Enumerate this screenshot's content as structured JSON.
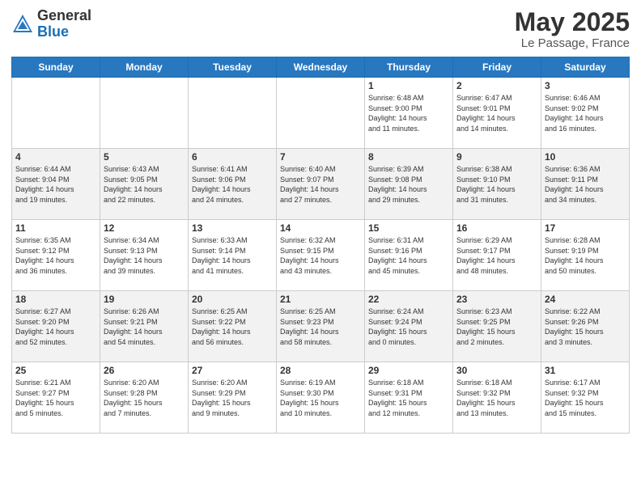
{
  "logo": {
    "general": "General",
    "blue": "Blue"
  },
  "title": "May 2025",
  "subtitle": "Le Passage, France",
  "days_of_week": [
    "Sunday",
    "Monday",
    "Tuesday",
    "Wednesday",
    "Thursday",
    "Friday",
    "Saturday"
  ],
  "weeks": [
    [
      {
        "day": "",
        "info": ""
      },
      {
        "day": "",
        "info": ""
      },
      {
        "day": "",
        "info": ""
      },
      {
        "day": "",
        "info": ""
      },
      {
        "day": "1",
        "info": "Sunrise: 6:48 AM\nSunset: 9:00 PM\nDaylight: 14 hours\nand 11 minutes."
      },
      {
        "day": "2",
        "info": "Sunrise: 6:47 AM\nSunset: 9:01 PM\nDaylight: 14 hours\nand 14 minutes."
      },
      {
        "day": "3",
        "info": "Sunrise: 6:46 AM\nSunset: 9:02 PM\nDaylight: 14 hours\nand 16 minutes."
      }
    ],
    [
      {
        "day": "4",
        "info": "Sunrise: 6:44 AM\nSunset: 9:04 PM\nDaylight: 14 hours\nand 19 minutes."
      },
      {
        "day": "5",
        "info": "Sunrise: 6:43 AM\nSunset: 9:05 PM\nDaylight: 14 hours\nand 22 minutes."
      },
      {
        "day": "6",
        "info": "Sunrise: 6:41 AM\nSunset: 9:06 PM\nDaylight: 14 hours\nand 24 minutes."
      },
      {
        "day": "7",
        "info": "Sunrise: 6:40 AM\nSunset: 9:07 PM\nDaylight: 14 hours\nand 27 minutes."
      },
      {
        "day": "8",
        "info": "Sunrise: 6:39 AM\nSunset: 9:08 PM\nDaylight: 14 hours\nand 29 minutes."
      },
      {
        "day": "9",
        "info": "Sunrise: 6:38 AM\nSunset: 9:10 PM\nDaylight: 14 hours\nand 31 minutes."
      },
      {
        "day": "10",
        "info": "Sunrise: 6:36 AM\nSunset: 9:11 PM\nDaylight: 14 hours\nand 34 minutes."
      }
    ],
    [
      {
        "day": "11",
        "info": "Sunrise: 6:35 AM\nSunset: 9:12 PM\nDaylight: 14 hours\nand 36 minutes."
      },
      {
        "day": "12",
        "info": "Sunrise: 6:34 AM\nSunset: 9:13 PM\nDaylight: 14 hours\nand 39 minutes."
      },
      {
        "day": "13",
        "info": "Sunrise: 6:33 AM\nSunset: 9:14 PM\nDaylight: 14 hours\nand 41 minutes."
      },
      {
        "day": "14",
        "info": "Sunrise: 6:32 AM\nSunset: 9:15 PM\nDaylight: 14 hours\nand 43 minutes."
      },
      {
        "day": "15",
        "info": "Sunrise: 6:31 AM\nSunset: 9:16 PM\nDaylight: 14 hours\nand 45 minutes."
      },
      {
        "day": "16",
        "info": "Sunrise: 6:29 AM\nSunset: 9:17 PM\nDaylight: 14 hours\nand 48 minutes."
      },
      {
        "day": "17",
        "info": "Sunrise: 6:28 AM\nSunset: 9:19 PM\nDaylight: 14 hours\nand 50 minutes."
      }
    ],
    [
      {
        "day": "18",
        "info": "Sunrise: 6:27 AM\nSunset: 9:20 PM\nDaylight: 14 hours\nand 52 minutes."
      },
      {
        "day": "19",
        "info": "Sunrise: 6:26 AM\nSunset: 9:21 PM\nDaylight: 14 hours\nand 54 minutes."
      },
      {
        "day": "20",
        "info": "Sunrise: 6:25 AM\nSunset: 9:22 PM\nDaylight: 14 hours\nand 56 minutes."
      },
      {
        "day": "21",
        "info": "Sunrise: 6:25 AM\nSunset: 9:23 PM\nDaylight: 14 hours\nand 58 minutes."
      },
      {
        "day": "22",
        "info": "Sunrise: 6:24 AM\nSunset: 9:24 PM\nDaylight: 15 hours\nand 0 minutes."
      },
      {
        "day": "23",
        "info": "Sunrise: 6:23 AM\nSunset: 9:25 PM\nDaylight: 15 hours\nand 2 minutes."
      },
      {
        "day": "24",
        "info": "Sunrise: 6:22 AM\nSunset: 9:26 PM\nDaylight: 15 hours\nand 3 minutes."
      }
    ],
    [
      {
        "day": "25",
        "info": "Sunrise: 6:21 AM\nSunset: 9:27 PM\nDaylight: 15 hours\nand 5 minutes."
      },
      {
        "day": "26",
        "info": "Sunrise: 6:20 AM\nSunset: 9:28 PM\nDaylight: 15 hours\nand 7 minutes."
      },
      {
        "day": "27",
        "info": "Sunrise: 6:20 AM\nSunset: 9:29 PM\nDaylight: 15 hours\nand 9 minutes."
      },
      {
        "day": "28",
        "info": "Sunrise: 6:19 AM\nSunset: 9:30 PM\nDaylight: 15 hours\nand 10 minutes."
      },
      {
        "day": "29",
        "info": "Sunrise: 6:18 AM\nSunset: 9:31 PM\nDaylight: 15 hours\nand 12 minutes."
      },
      {
        "day": "30",
        "info": "Sunrise: 6:18 AM\nSunset: 9:32 PM\nDaylight: 15 hours\nand 13 minutes."
      },
      {
        "day": "31",
        "info": "Sunrise: 6:17 AM\nSunset: 9:32 PM\nDaylight: 15 hours\nand 15 minutes."
      }
    ]
  ]
}
